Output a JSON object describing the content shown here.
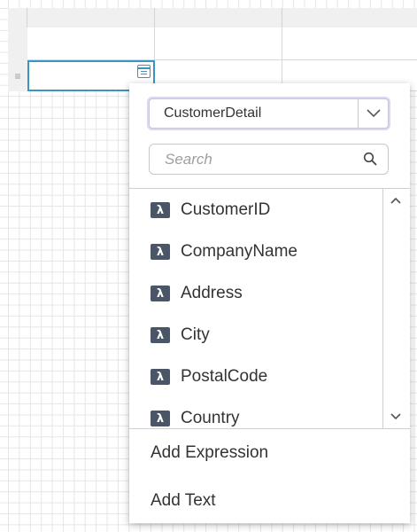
{
  "popup": {
    "data_source": {
      "selected": "CustomerDetail"
    },
    "search": {
      "placeholder": "Search",
      "value": ""
    },
    "fields": [
      {
        "label": "CustomerID",
        "icon": "lambda-icon"
      },
      {
        "label": "CompanyName",
        "icon": "lambda-icon"
      },
      {
        "label": "Address",
        "icon": "lambda-icon"
      },
      {
        "label": "City",
        "icon": "lambda-icon"
      },
      {
        "label": "PostalCode",
        "icon": "lambda-icon"
      },
      {
        "label": "Country",
        "icon": "lambda-icon"
      }
    ],
    "lambda_glyph": "λ",
    "actions": {
      "add_expression": "Add Expression",
      "add_text": "Add Text"
    }
  },
  "grid": {
    "row_handle_glyph": "≡"
  },
  "colors": {
    "accent": "#3a95c5",
    "lambda_bg": "#4a5668",
    "focus_ring": "#dcd6f7"
  }
}
